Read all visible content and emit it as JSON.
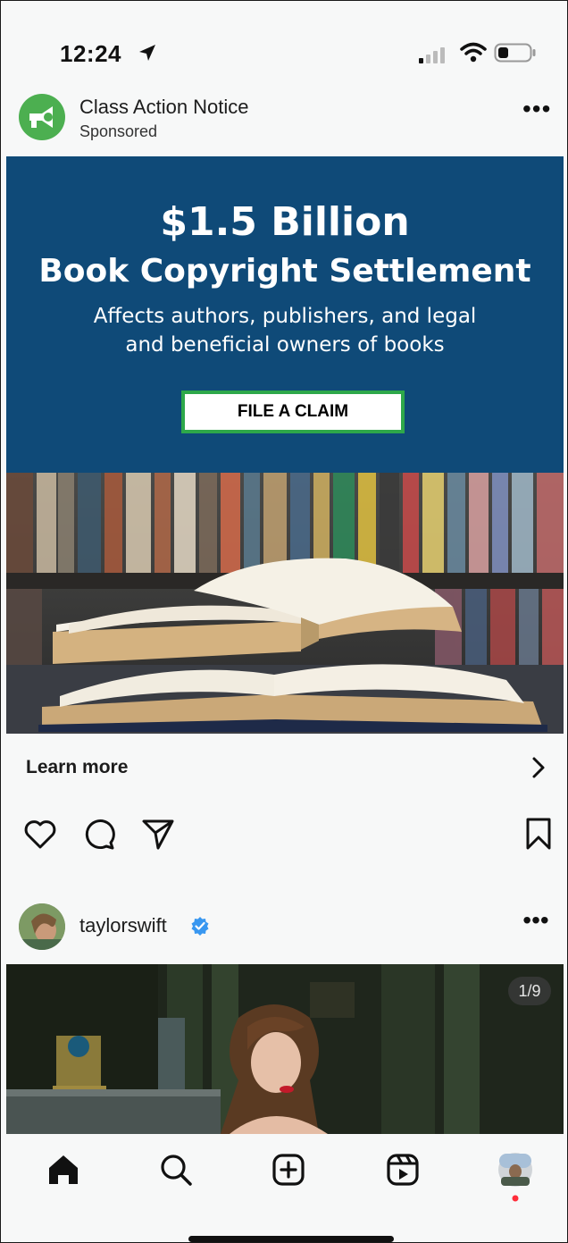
{
  "status_bar": {
    "time": "12:24"
  },
  "ad_post": {
    "account_name": "Class Action Notice",
    "sponsored_label": "Sponsored",
    "more_label": "•••",
    "banner": {
      "headline": "$1.5 Billion",
      "subheadline": "Book Copyright Settlement",
      "body_line1": "Affects authors, publishers, and legal",
      "body_line2": "and beneficial owners of books",
      "cta_label": "FILE A CLAIM",
      "background_color": "#0f4a78",
      "cta_border_color": "#2ea84a"
    },
    "learn_more_label": "Learn more"
  },
  "actions": {
    "icons": [
      "heart-icon",
      "comment-icon",
      "share-icon",
      "bookmark-icon"
    ]
  },
  "second_post": {
    "username": "taylorswift",
    "more_label": "•••",
    "image_counter": "1/9"
  },
  "tab_bar": {
    "items": [
      "home-icon",
      "search-icon",
      "create-icon",
      "reels-icon",
      "profile-icon"
    ]
  }
}
